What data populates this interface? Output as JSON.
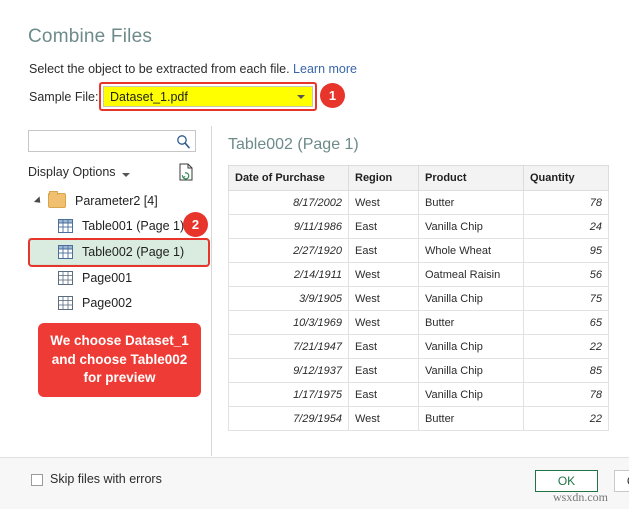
{
  "dialog": {
    "title": "Combine Files",
    "subtitle": "Select the object to be extracted from each file.",
    "learn_more": "Learn more"
  },
  "sample_file": {
    "label": "Sample File:",
    "value": "Dataset_1.pdf",
    "caret_icon": "chevron-down-icon"
  },
  "annotations": {
    "badge_1": "1",
    "badge_2": "2",
    "callout_text": "We choose Dataset_1 and choose Table002 for preview",
    "highlight_color": "#e8352c",
    "callout_bg": "#ee3b35"
  },
  "left_panel": {
    "search_placeholder": "",
    "search_value": "",
    "search_icon": "search-icon",
    "display_options_label": "Display Options",
    "display_options_caret": "chevron-down-icon",
    "refresh_icon": "page-refresh-icon",
    "tree": [
      {
        "label": "Parameter2 [4]",
        "icon": "folder-icon",
        "level": 0,
        "selected": false,
        "expanded": true
      },
      {
        "label": "Table001 (Page 1)",
        "icon": "table-icon",
        "level": 1,
        "selected": false
      },
      {
        "label": "Table002 (Page 1)",
        "icon": "table-icon",
        "level": 1,
        "selected": true
      },
      {
        "label": "Page001",
        "icon": "page-grid-icon",
        "level": 1,
        "selected": false
      },
      {
        "label": "Page002",
        "icon": "page-grid-icon",
        "level": 1,
        "selected": false
      }
    ]
  },
  "preview": {
    "title": "Table002 (Page 1)",
    "columns": [
      "Date of Purchase",
      "Region",
      "Product",
      "Quantity"
    ],
    "rows": [
      [
        "8/17/2002",
        "West",
        "Butter",
        "78"
      ],
      [
        "9/11/1986",
        "East",
        "Vanilla Chip",
        "24"
      ],
      [
        "2/27/1920",
        "East",
        "Whole Wheat",
        "95"
      ],
      [
        "2/14/1911",
        "West",
        "Oatmeal Raisin",
        "56"
      ],
      [
        "3/9/1905",
        "West",
        "Vanilla Chip",
        "75"
      ],
      [
        "10/3/1969",
        "West",
        "Butter",
        "65"
      ],
      [
        "7/21/1947",
        "East",
        "Vanilla Chip",
        "22"
      ],
      [
        "9/12/1937",
        "East",
        "Vanilla Chip",
        "85"
      ],
      [
        "1/17/1975",
        "East",
        "Vanilla Chip",
        "78"
      ],
      [
        "7/29/1954",
        "West",
        "Butter",
        "22"
      ]
    ]
  },
  "footer": {
    "skip_label": "Skip files with errors",
    "skip_checked": false,
    "ok_label": "OK",
    "cancel_label": "Cancel",
    "ok_color": "#217346"
  },
  "watermark": "wsxdn.com"
}
